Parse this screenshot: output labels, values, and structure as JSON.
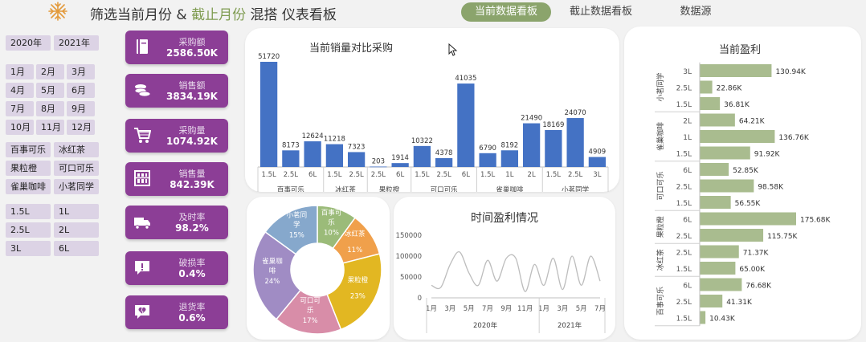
{
  "header": {
    "title_part1": "筛选当前月份 & ",
    "title_part2": "截止月份",
    "title_part3": " 混搭 仪表看板",
    "tabs": [
      {
        "label": "当前数据看板"
      },
      {
        "label": "截止数据看板"
      },
      {
        "label": "数据源"
      }
    ]
  },
  "slicers": {
    "years": [
      "2020年",
      "2021年"
    ],
    "months": [
      "1月",
      "2月",
      "3月",
      "4月",
      "5月",
      "6月",
      "7月",
      "8月",
      "9月",
      "10月",
      "11月",
      "12月"
    ],
    "brands": [
      "百事可乐",
      "冰红茶",
      "果粒橙",
      "可口可乐",
      "雀巢咖啡",
      "小茗同学"
    ],
    "sizes": [
      "1.5L",
      "1L",
      "2.5L",
      "2L",
      "3L",
      "6L"
    ]
  },
  "kpis": [
    {
      "label": "采购额",
      "value": "2586.50K",
      "icon": "ledger-icon"
    },
    {
      "label": "销售额",
      "value": "3834.19K",
      "icon": "coins-icon"
    },
    {
      "label": "采购量",
      "value": "1074.92K",
      "icon": "cart-icon"
    },
    {
      "label": "销售量",
      "value": "842.39K",
      "icon": "abacus-icon"
    },
    {
      "label": "及时率",
      "value": "98.2%",
      "icon": "truck-icon"
    },
    {
      "label": "破损率",
      "value": "0.4%",
      "icon": "alert-message-icon"
    },
    {
      "label": "退货率",
      "value": "0.6%",
      "icon": "broken-heart-icon"
    }
  ],
  "colors": {
    "accent_green": "#8ba46c",
    "kpi_purple": "#8c3e96",
    "bar_blue": "#4472c4",
    "bar_green": "#a9bc8f"
  },
  "chart_data": [
    {
      "type": "bar",
      "title": "当前销量对比采购",
      "groups": [
        {
          "name": "百事可乐",
          "categories": [
            "1.5L",
            "2.5L",
            "6L"
          ],
          "values": [
            51720,
            8173,
            12624
          ]
        },
        {
          "name": "冰红茶",
          "categories": [
            "1.5L",
            "2.5L"
          ],
          "values": [
            11218,
            7323
          ]
        },
        {
          "name": "果粒橙",
          "categories": [
            "2.5L",
            "6L"
          ],
          "values": [
            203,
            1914
          ]
        },
        {
          "name": "可口可乐",
          "categories": [
            "1.5L",
            "2.5L",
            "6L"
          ],
          "values": [
            10322,
            4378,
            41035
          ]
        },
        {
          "name": "雀巢咖啡",
          "categories": [
            "1.5L",
            "1L",
            "2L"
          ],
          "values": [
            6790,
            8192,
            21490
          ]
        },
        {
          "name": "小茗同学",
          "categories": [
            "1.5L",
            "2.5L",
            "3L"
          ],
          "values": [
            18169,
            24070,
            4909
          ]
        }
      ]
    },
    {
      "type": "pie",
      "slices": [
        {
          "name": "百事可乐",
          "value": 10,
          "label": "10%",
          "color": "#9bbb79"
        },
        {
          "name": "冰红茶",
          "value": 11,
          "label": "11%",
          "color": "#f0a04b"
        },
        {
          "name": "果粒橙",
          "value": 23,
          "label": "23%",
          "color": "#e2b722"
        },
        {
          "name": "可口可乐",
          "value": 17,
          "label": "17%",
          "color": "#d88da8"
        },
        {
          "name": "雀巢咖啡",
          "value": 24,
          "label": "24%",
          "color": "#a08cc4"
        },
        {
          "name": "小茗同学",
          "value": 15,
          "label": "15%",
          "color": "#86a8cc"
        }
      ]
    },
    {
      "type": "line",
      "title": "时间盈利情况",
      "x": [
        "2020-01",
        "2020-02",
        "2020-03",
        "2020-04",
        "2020-05",
        "2020-06",
        "2020-07",
        "2020-08",
        "2020-09",
        "2020-10",
        "2020-11",
        "2020-12",
        "2021-01",
        "2021-02",
        "2021-03",
        "2021-04",
        "2021-05",
        "2021-06",
        "2021-07"
      ],
      "values": [
        30000,
        25000,
        80000,
        110000,
        60000,
        30000,
        90000,
        40000,
        95000,
        95000,
        15000,
        80000,
        30000,
        95000,
        20000,
        100000,
        30000,
        100000,
        40000
      ],
      "xtick_labels": [
        "1月",
        "3月",
        "5月",
        "7月",
        "9月",
        "11月",
        "1月",
        "3月",
        "5月",
        "7月"
      ],
      "year_labels": [
        "2020年",
        "2021年"
      ],
      "yticks": [
        "0",
        "50000",
        "100000",
        "150000"
      ],
      "ylim": [
        0,
        150000
      ]
    },
    {
      "type": "bar",
      "orientation": "horizontal",
      "title": "当前盈利",
      "groups": [
        {
          "name": "小茗同学",
          "categories": [
            "3L",
            "2.5L",
            "1.5L"
          ],
          "values": [
            130.94,
            22.86,
            36.81
          ],
          "labels": [
            "130.94K",
            "22.86K",
            "36.81K"
          ]
        },
        {
          "name": "雀巢咖啡",
          "categories": [
            "2L",
            "1L",
            "1.5L"
          ],
          "values": [
            64.21,
            136.76,
            91.92
          ],
          "labels": [
            "64.21K",
            "136.76K",
            "91.92K"
          ]
        },
        {
          "name": "可口可乐",
          "categories": [
            "6L",
            "2.5L",
            "1.5L"
          ],
          "values": [
            52.85,
            98.58,
            56.55
          ],
          "labels": [
            "52.85K",
            "98.58K",
            "56.55K"
          ]
        },
        {
          "name": "果粒橙",
          "categories": [
            "6L",
            "2.5L"
          ],
          "values": [
            175.68,
            115.75
          ],
          "labels": [
            "175.68K",
            "115.75K"
          ]
        },
        {
          "name": "冰红茶",
          "categories": [
            "2.5L",
            "1.5L"
          ],
          "values": [
            71.37,
            65.0
          ],
          "labels": [
            "71.37K",
            "65.00K"
          ]
        },
        {
          "name": "百事可乐",
          "categories": [
            "6L",
            "2.5L",
            "1.5L"
          ],
          "values": [
            76.68,
            41.31,
            10.43
          ],
          "labels": [
            "76.68K",
            "41.31K",
            "10.43K"
          ]
        }
      ]
    }
  ]
}
